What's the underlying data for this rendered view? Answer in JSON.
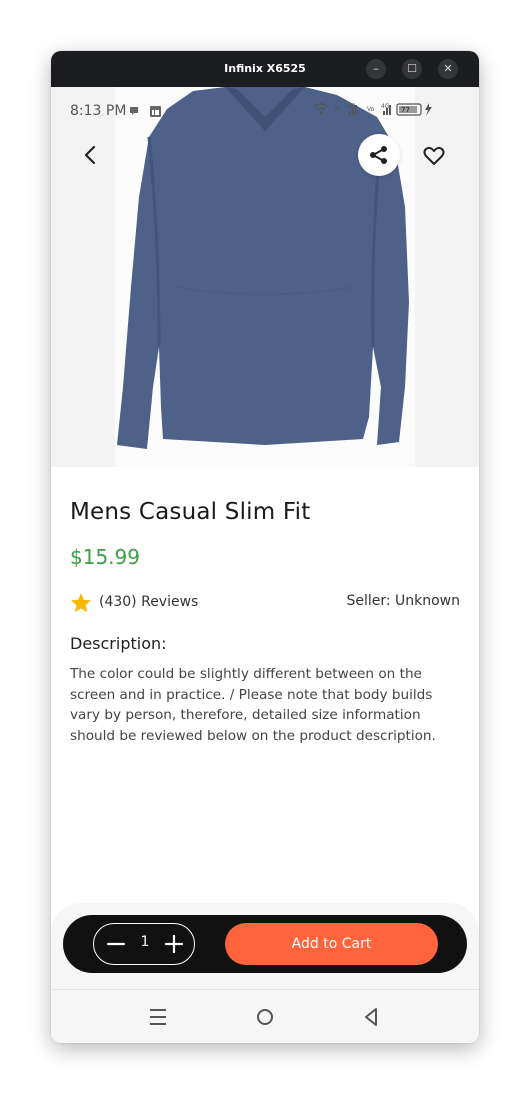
{
  "window": {
    "title": "Infinix X6525",
    "controls": {
      "minimize": "–",
      "maximize": "☐",
      "close": "✕"
    }
  },
  "status_bar": {
    "time": "8:13 PM",
    "battery": "77",
    "network": [
      "4G",
      "4G"
    ]
  },
  "product": {
    "title": "Mens Casual Slim Fit",
    "price": "$15.99",
    "reviews": "(430) Reviews",
    "rating_icon": "star-icon",
    "seller": "Seller: Unknown",
    "description_label": "Description:",
    "description": "The color could be slightly different between on the screen and in practice. / Please note that body builds vary by person, therefore, detailed size information should be reviewed below on the product description."
  },
  "cart": {
    "quantity": "1",
    "add_label": "Add to Cart"
  },
  "colors": {
    "price": "#3aa044",
    "accent": "#ff643d",
    "cart_bar": "#111111"
  },
  "icons": [
    "back-arrow-icon",
    "share-icon",
    "heart-icon",
    "minus-icon",
    "plus-icon",
    "menu-icon",
    "home-circle-icon",
    "back-triangle-icon"
  ]
}
